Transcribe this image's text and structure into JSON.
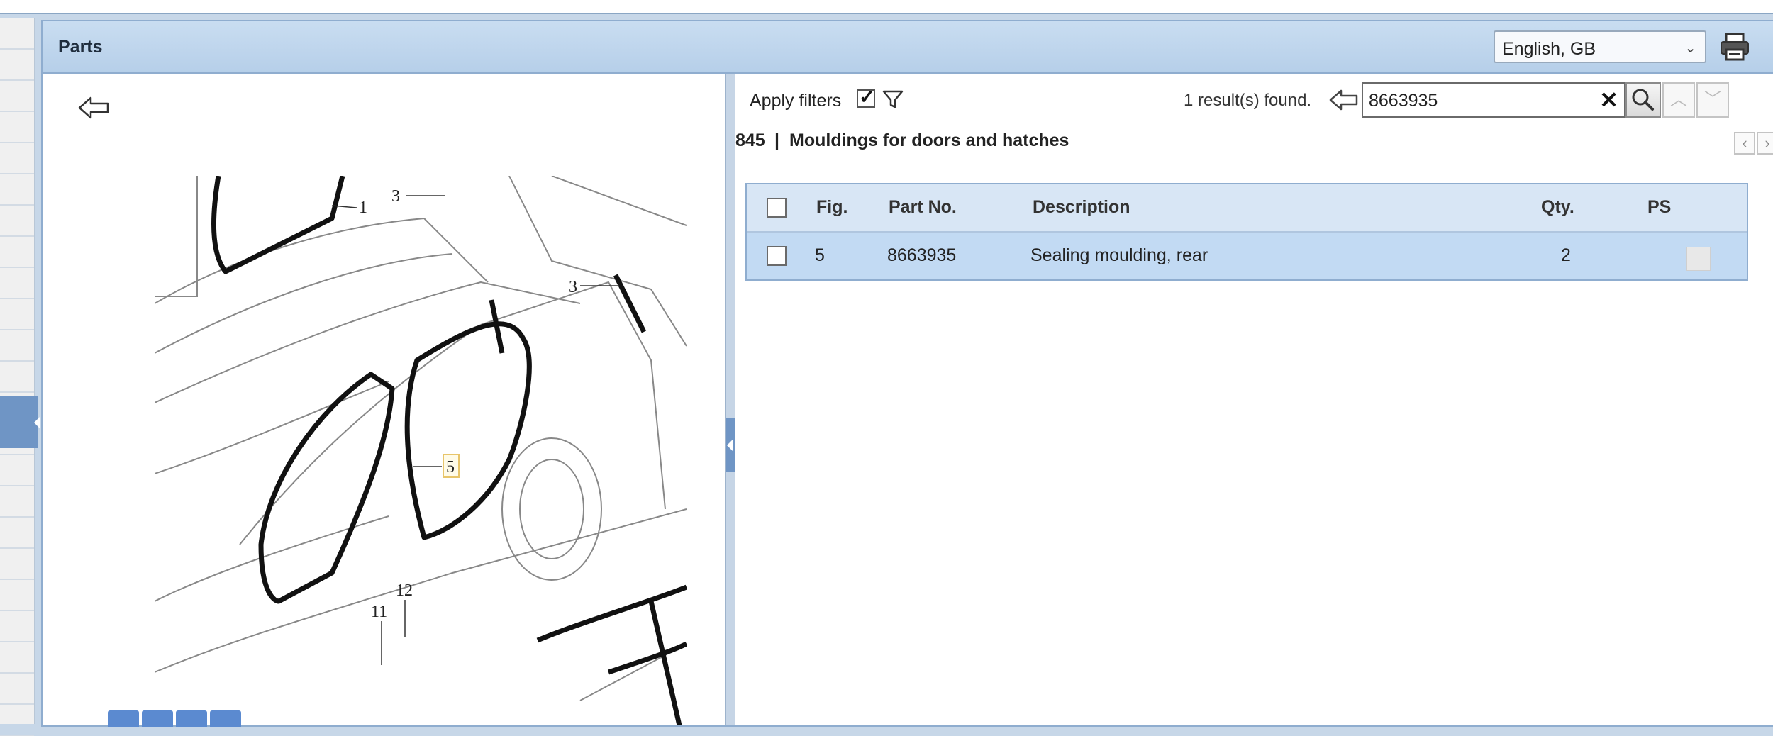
{
  "header": {
    "title": "Parts",
    "language": "English, GB"
  },
  "filters": {
    "apply_label": "Apply filters",
    "apply_checked": true
  },
  "search": {
    "result_text": "1 result(s) found.",
    "value": "8663935"
  },
  "section": {
    "number": "845",
    "separator": "|",
    "title": "Mouldings for doors and hatches"
  },
  "table": {
    "columns": {
      "fig": "Fig.",
      "part_no": "Part No.",
      "description": "Description",
      "qty": "Qty.",
      "ps": "PS"
    },
    "rows": [
      {
        "fig": "5",
        "part_no": "8663935",
        "description": "Sealing moulding, rear",
        "qty": "2",
        "ps": ""
      }
    ]
  },
  "diagram": {
    "callouts": [
      "1",
      "3",
      "3",
      "5",
      "12",
      "11"
    ]
  },
  "icons": {
    "back": "back-arrow-icon",
    "print": "printer-icon",
    "filter": "funnel-icon",
    "search": "magnifier-icon",
    "clear": "close-icon",
    "nav_up": "chevron-up-icon",
    "nav_down": "chevron-down-icon",
    "note": "note-icon"
  }
}
